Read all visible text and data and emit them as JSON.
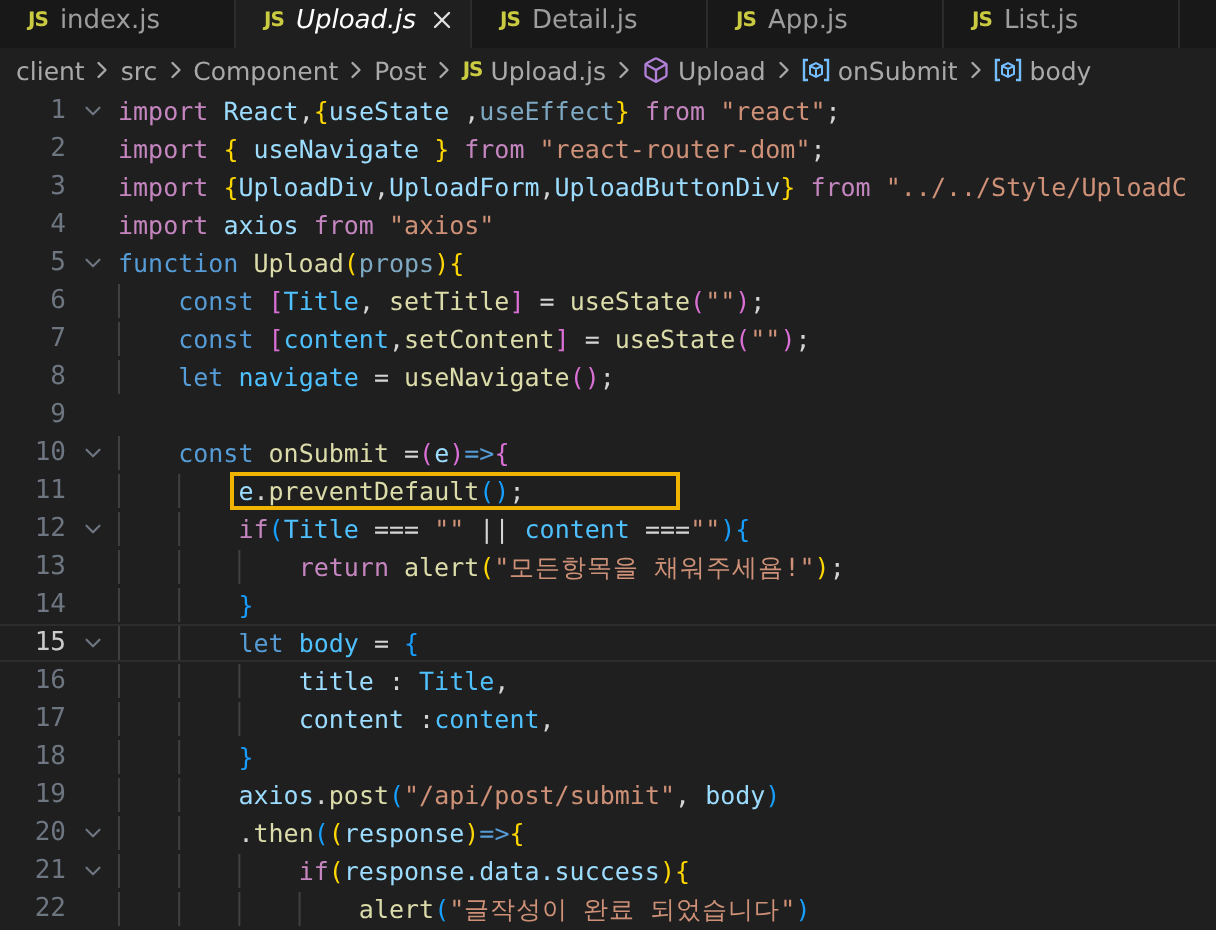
{
  "tabs": [
    {
      "icon": "JS",
      "label": "index.js",
      "selected": false
    },
    {
      "icon": "JS",
      "label": "Upload.js",
      "selected": true
    },
    {
      "icon": "JS",
      "label": "Detail.js",
      "selected": false
    },
    {
      "icon": "JS",
      "label": "App.js",
      "selected": false
    },
    {
      "icon": "JS",
      "label": "List.js",
      "selected": false
    }
  ],
  "breadcrumb": [
    {
      "kind": "folder",
      "label": "client"
    },
    {
      "kind": "folder",
      "label": "src"
    },
    {
      "kind": "folder",
      "label": "Component"
    },
    {
      "kind": "folder",
      "label": "Post"
    },
    {
      "kind": "file",
      "icon": "JS",
      "label": "Upload.js"
    },
    {
      "kind": "class",
      "label": "Upload"
    },
    {
      "kind": "variable",
      "label": "onSubmit"
    },
    {
      "kind": "variable",
      "label": "body"
    }
  ],
  "lines": [
    {
      "number": "1",
      "fold": true,
      "tokens": [
        {
          "kind": "kw",
          "text": "import "
        },
        {
          "kind": "var",
          "text": "React"
        },
        {
          "kind": "p",
          "text": ","
        },
        {
          "kind": "b1",
          "text": "{"
        },
        {
          "kind": "var",
          "text": "useState"
        },
        {
          "kind": "p",
          "text": " ,"
        },
        {
          "kind": "dim",
          "text": "useEffect"
        },
        {
          "kind": "b1",
          "text": "} "
        },
        {
          "kind": "kw",
          "text": "from "
        },
        {
          "kind": "str",
          "text": "\"react\""
        },
        {
          "kind": "p",
          "text": ";"
        }
      ]
    },
    {
      "number": "2",
      "tokens": [
        {
          "kind": "kw",
          "text": "import "
        },
        {
          "kind": "b1",
          "text": "{ "
        },
        {
          "kind": "var",
          "text": "useNavigate "
        },
        {
          "kind": "b1",
          "text": "} "
        },
        {
          "kind": "kw",
          "text": "from "
        },
        {
          "kind": "str",
          "text": "\"react-router-dom\""
        },
        {
          "kind": "p",
          "text": ";"
        }
      ]
    },
    {
      "number": "3",
      "tokens": [
        {
          "kind": "kw",
          "text": "import "
        },
        {
          "kind": "b1",
          "text": "{"
        },
        {
          "kind": "var",
          "text": "UploadDiv"
        },
        {
          "kind": "p",
          "text": ","
        },
        {
          "kind": "var",
          "text": "UploadForm"
        },
        {
          "kind": "p",
          "text": ","
        },
        {
          "kind": "var",
          "text": "UploadButtonDiv"
        },
        {
          "kind": "b1",
          "text": "} "
        },
        {
          "kind": "kw",
          "text": "from "
        },
        {
          "kind": "str",
          "text": "\"../../Style/UploadC"
        }
      ]
    },
    {
      "number": "4",
      "tokens": [
        {
          "kind": "kw",
          "text": "import "
        },
        {
          "kind": "var",
          "text": "axios "
        },
        {
          "kind": "kw",
          "text": "from "
        },
        {
          "kind": "str",
          "text": "\"axios\""
        }
      ]
    },
    {
      "number": "5",
      "fold": true,
      "tokens": [
        {
          "kind": "st",
          "text": "function "
        },
        {
          "kind": "fn",
          "text": "Upload"
        },
        {
          "kind": "b1",
          "text": "("
        },
        {
          "kind": "dim",
          "text": "props"
        },
        {
          "kind": "b1",
          "text": "){"
        }
      ]
    },
    {
      "number": "6",
      "tokens": [
        {
          "kind": "st",
          "text": "    const "
        },
        {
          "kind": "b2",
          "text": "["
        },
        {
          "kind": "cst",
          "text": "Title"
        },
        {
          "kind": "p",
          "text": ", "
        },
        {
          "kind": "fn",
          "text": "setTitle"
        },
        {
          "kind": "b2",
          "text": "]"
        },
        {
          "kind": "p",
          "text": " = "
        },
        {
          "kind": "fn",
          "text": "useState"
        },
        {
          "kind": "b2",
          "text": "("
        },
        {
          "kind": "str",
          "text": "\"\""
        },
        {
          "kind": "b2",
          "text": ")"
        },
        {
          "kind": "p",
          "text": ";"
        }
      ]
    },
    {
      "number": "7",
      "tokens": [
        {
          "kind": "st",
          "text": "    const "
        },
        {
          "kind": "b2",
          "text": "["
        },
        {
          "kind": "cst",
          "text": "content"
        },
        {
          "kind": "p",
          "text": ","
        },
        {
          "kind": "fn",
          "text": "setContent"
        },
        {
          "kind": "b2",
          "text": "]"
        },
        {
          "kind": "p",
          "text": " = "
        },
        {
          "kind": "fn",
          "text": "useState"
        },
        {
          "kind": "b2",
          "text": "("
        },
        {
          "kind": "str",
          "text": "\"\""
        },
        {
          "kind": "b2",
          "text": ")"
        },
        {
          "kind": "p",
          "text": ";"
        }
      ]
    },
    {
      "number": "8",
      "tokens": [
        {
          "kind": "st",
          "text": "    let "
        },
        {
          "kind": "cst",
          "text": "navigate"
        },
        {
          "kind": "p",
          "text": " = "
        },
        {
          "kind": "fn",
          "text": "useNavigate"
        },
        {
          "kind": "b2",
          "text": "()"
        },
        {
          "kind": "p",
          "text": ";"
        }
      ]
    },
    {
      "number": "9"
    },
    {
      "number": "10",
      "fold": true,
      "tokens": [
        {
          "kind": "st",
          "text": "    const "
        },
        {
          "kind": "fn",
          "text": "onSubmit"
        },
        {
          "kind": "p",
          "text": " ="
        },
        {
          "kind": "b2",
          "text": "("
        },
        {
          "kind": "var",
          "text": "e"
        },
        {
          "kind": "b2",
          "text": ")"
        },
        {
          "kind": "st",
          "text": "=>"
        },
        {
          "kind": "b2",
          "text": "{"
        }
      ]
    },
    {
      "number": "11",
      "boxed": true,
      "tokens": [
        {
          "kind": "var",
          "text": "        e"
        },
        {
          "kind": "p",
          "text": "."
        },
        {
          "kind": "fn",
          "text": "preventDefault"
        },
        {
          "kind": "b3",
          "text": "()"
        },
        {
          "kind": "p",
          "text": ";"
        }
      ]
    },
    {
      "number": "12",
      "fold": true,
      "tokens": [
        {
          "kind": "kw",
          "text": "        if"
        },
        {
          "kind": "b3",
          "text": "("
        },
        {
          "kind": "cst",
          "text": "Title"
        },
        {
          "kind": "p",
          "text": " === "
        },
        {
          "kind": "str",
          "text": "\"\""
        },
        {
          "kind": "p",
          "text": " || "
        },
        {
          "kind": "cst",
          "text": "content"
        },
        {
          "kind": "p",
          "text": " ==="
        },
        {
          "kind": "str",
          "text": "\"\""
        },
        {
          "kind": "b3",
          "text": "){"
        }
      ]
    },
    {
      "number": "13",
      "tokens": [
        {
          "kind": "kw",
          "text": "            return "
        },
        {
          "kind": "fn",
          "text": "alert"
        },
        {
          "kind": "b1",
          "text": "("
        },
        {
          "kind": "str",
          "text": "\"모든항목을 채워주세욤!\""
        },
        {
          "kind": "b1",
          "text": ")"
        },
        {
          "kind": "p",
          "text": ";"
        }
      ]
    },
    {
      "number": "14",
      "tokens": [
        {
          "kind": "b3",
          "text": "        }"
        }
      ]
    },
    {
      "number": "15",
      "fold": true,
      "current": true,
      "tokens": [
        {
          "kind": "st",
          "text": "        let "
        },
        {
          "kind": "cst",
          "text": "body"
        },
        {
          "kind": "p",
          "text": " = "
        },
        {
          "kind": "b3",
          "text": "{"
        }
      ]
    },
    {
      "number": "16",
      "tokens": [
        {
          "kind": "var",
          "text": "            title"
        },
        {
          "kind": "p",
          "text": " : "
        },
        {
          "kind": "cst",
          "text": "Title"
        },
        {
          "kind": "p",
          "text": ","
        }
      ]
    },
    {
      "number": "17",
      "tokens": [
        {
          "kind": "var",
          "text": "            content"
        },
        {
          "kind": "p",
          "text": " :"
        },
        {
          "kind": "cst",
          "text": "content"
        },
        {
          "kind": "p",
          "text": ","
        }
      ]
    },
    {
      "number": "18",
      "tokens": [
        {
          "kind": "b3",
          "text": "        }"
        }
      ]
    },
    {
      "number": "19",
      "tokens": [
        {
          "kind": "var",
          "text": "        axios"
        },
        {
          "kind": "p",
          "text": "."
        },
        {
          "kind": "fn",
          "text": "post"
        },
        {
          "kind": "b3",
          "text": "("
        },
        {
          "kind": "str",
          "text": "\"/api/post/submit\""
        },
        {
          "kind": "p",
          "text": ", "
        },
        {
          "kind": "var",
          "text": "body"
        },
        {
          "kind": "b3",
          "text": ")"
        }
      ]
    },
    {
      "number": "20",
      "fold": true,
      "tokens": [
        {
          "kind": "p",
          "text": "        ."
        },
        {
          "kind": "fn",
          "text": "then"
        },
        {
          "kind": "b3",
          "text": "("
        },
        {
          "kind": "b1",
          "text": "("
        },
        {
          "kind": "var",
          "text": "response"
        },
        {
          "kind": "b1",
          "text": ")"
        },
        {
          "kind": "st",
          "text": "=>"
        },
        {
          "kind": "b1",
          "text": "{"
        }
      ]
    },
    {
      "number": "21",
      "fold": true,
      "tokens": [
        {
          "kind": "kw",
          "text": "            if"
        },
        {
          "kind": "b1",
          "text": "("
        },
        {
          "kind": "var",
          "text": "response.data.success"
        },
        {
          "kind": "b1",
          "text": "){"
        }
      ]
    },
    {
      "number": "22",
      "tokens": [
        {
          "kind": "fn",
          "text": "                alert"
        },
        {
          "kind": "b3",
          "text": "("
        },
        {
          "kind": "str",
          "text": "\"글작성이 완료 되었습니다\""
        },
        {
          "kind": "b3",
          "text": ")"
        }
      ]
    }
  ]
}
